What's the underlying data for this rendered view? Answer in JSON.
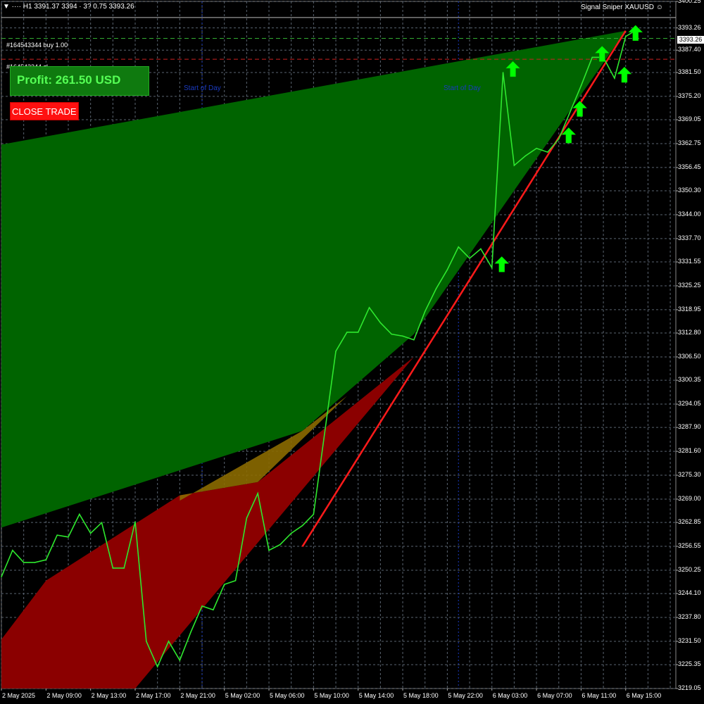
{
  "header": {
    "info": "▼ ···· H1  3391.37 3394 · 3?  0.75 3393.26",
    "indicator_title": "Signal Sniper XAUUSD ☺"
  },
  "orders": {
    "buy_label": "#164543344 buy 1.00",
    "sl_label": "#164543344 sl"
  },
  "panel": {
    "profit_text": "Profit: 261.50 USD",
    "close_button": "CLOSE TRADE"
  },
  "start_of_day_label": "Start of Day",
  "current_price": "3393.26",
  "colors": {
    "background": "#000000",
    "grid": "#5a6470",
    "price_line": "#2ee82e",
    "trend_line": "#ff1a1a",
    "green_zone": "#006400",
    "red_zone": "#8b0000",
    "overlap_zone": "#8b6a00",
    "buy_arrow": "#00ff00",
    "order_buy_line": "#33aa33",
    "order_sl_line": "#cc2222",
    "session_line": "#1a3ac0"
  },
  "icons": {
    "buy_signal": "up-arrow-icon"
  },
  "chart_data": {
    "type": "line",
    "symbol": "XAUUSD",
    "timeframe": "H1",
    "x_tick_labels": [
      "2 May 2025",
      "2 May 09:00",
      "2 May 13:00",
      "2 May 17:00",
      "2 May 21:00",
      "5 May 02:00",
      "5 May 06:00",
      "5 May 10:00",
      "5 May 14:00",
      "5 May 18:00",
      "5 May 22:00",
      "6 May 03:00",
      "6 May 07:00",
      "6 May 11:00",
      "6 May 15:00"
    ],
    "y_tick_labels": [
      "3400.25",
      "3393.26",
      "3387.40",
      "3381.50",
      "3375.20",
      "3369.05",
      "3362.75",
      "3356.45",
      "3350.30",
      "3344.00",
      "3337.70",
      "3331.55",
      "3325.25",
      "3318.95",
      "3312.80",
      "3306.50",
      "3300.35",
      "3294.05",
      "3287.90",
      "3281.60",
      "3275.30",
      "3269.00",
      "3262.85",
      "3256.55",
      "3250.25",
      "3244.10",
      "3237.80",
      "3231.50",
      "3225.35",
      "3219.05"
    ],
    "ylim": [
      3219.05,
      3400.25
    ],
    "xlim": [
      0,
      60.5
    ],
    "grid": true,
    "series": [
      {
        "values": [
          3248.5,
          3255.5,
          3252.3,
          3252.3,
          3253.0,
          3259.5,
          3259.0,
          3265.0,
          3260.0,
          3262.8,
          3250.8,
          3250.8,
          3263.0,
          3231.5,
          3224.8,
          3231.5,
          3226.5,
          3234.0,
          3240.8,
          3239.8,
          3246.5,
          3247.5,
          3264.0,
          3270.5,
          3255.5,
          3257.0,
          3260.0,
          3262.0,
          3265.0,
          3286.5,
          3308.0,
          3313.0,
          3313.0,
          3319.5,
          3315.5,
          3312.5,
          3312.0,
          3311.0,
          3318.5,
          3324.5,
          3329.5,
          3335.5,
          3332.5,
          3335.0,
          3330.0,
          3381.5,
          3357.0,
          3359.5,
          3361.5,
          3360.5,
          3364.0,
          3371.0,
          3378.0,
          3385.5,
          3385.5,
          3380.0,
          3391.0,
          3392.8
        ]
      }
    ],
    "buy_arrows_at": [
      44,
      45,
      50,
      51,
      53,
      55,
      56
    ],
    "trend_line": {
      "from": [
        27,
        3256.5
      ],
      "to": [
        56,
        3392.5
      ]
    },
    "green_zone_upper": {
      "from": [
        0,
        3362.5
      ],
      "to": [
        56,
        3392.5
      ]
    },
    "green_zone_lower": [
      [
        0,
        3261.5
      ],
      [
        27,
        3287.0
      ],
      [
        37,
        3312.5
      ],
      [
        56,
        3392.5
      ]
    ],
    "red_zone_upper": [
      [
        0,
        3232.0
      ],
      [
        4,
        3247.5
      ],
      [
        16,
        3270.0
      ],
      [
        23,
        3273.5
      ],
      [
        37,
        3306.5
      ]
    ],
    "red_zone_lower": {
      "from": [
        12,
        3219.05
      ],
      "to": [
        37,
        3306.5
      ]
    },
    "order_buy_price": 3390.5,
    "order_sl_price": 3385.0,
    "start_of_day_at": [
      18,
      41
    ]
  }
}
